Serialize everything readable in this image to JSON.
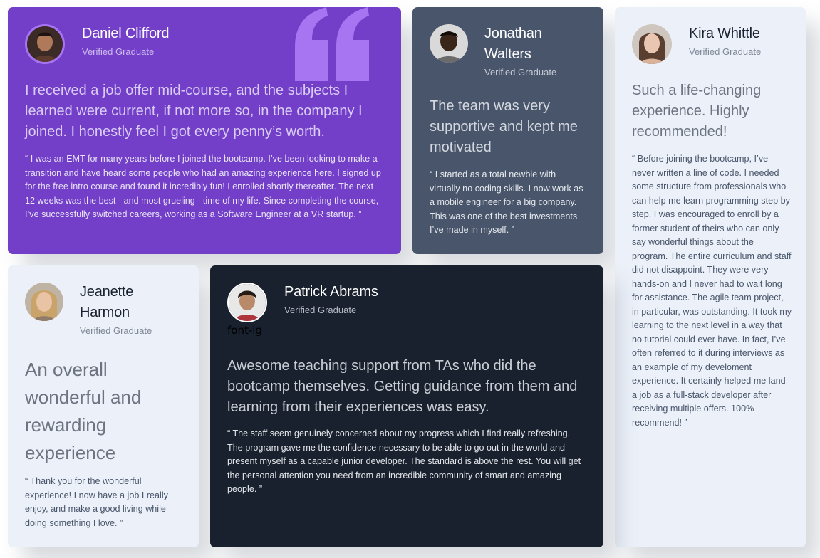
{
  "colors": {
    "purple": "#733fc8",
    "slate": "#48556a",
    "light": "#ecf1f9",
    "dark": "#19212e",
    "quote_mark": "#a775f1"
  },
  "testimonials": [
    {
      "name": "Daniel Clifford",
      "role": "Verified Graduate",
      "headline": "I received a job offer mid-course, and the subjects I learned were current, if not more so, in the company I joined. I honestly feel I got every penny’s worth.",
      "quote": "“ I was an EMT for many years before I joined the bootcamp. I’ve been looking to make a transition and have heard some people who had an amazing experience here. I signed up for the free intro course and found it incredibly fun! I enrolled shortly thereafter. The next 12 weeks was the best - and most grueling - time of my life. Since completing the course, I’ve successfully switched careers, working as a Software Engineer at a VR startup. ”"
    },
    {
      "name": "Jonathan Walters",
      "role": "Verified Graduate",
      "headline": "The team was very supportive and kept me motivated",
      "quote": "“ I started as a total newbie with virtually no coding skills. I now work as a mobile engineer for a big company. This was one of the best investments I’ve made in myself. ”"
    },
    {
      "name": "Kira Whittle",
      "role": "Verified Graduate",
      "headline": "Such a life-changing experience. Highly recommended!",
      "quote": "“ Before joining the bootcamp, I’ve never written a line of code. I needed some structure from professionals who can help me learn programming step by step. I was encouraged to enroll by a former student of theirs who can only say wonderful things about the program. The entire curriculum and staff did not disappoint. They were very hands-on and I never had to wait long for assistance. The agile team project, in particular, was outstanding. It took my learning to the next level in a way that no tutorial could ever have. In fact, I’ve often referred to it during interviews as an example of my develoment experience. It certainly helped me land a job as a full-stack developer after receiving multiple offers. 100% recommend! ”"
    },
    {
      "name": "Jeanette Harmon",
      "role": "Verified Graduate",
      "headline": "An overall wonderful and rewarding experience",
      "quote": "“ Thank you for the wonderful experience! I now have a job I really enjoy, and make a good living while doing something I love. ”"
    },
    {
      "name": "Patrick Abrams",
      "role": "Verified Graduate",
      "stray_label": "font-lg",
      "headline": "Awesome teaching support from TAs who did the bootcamp themselves. Getting guidance from them and learning from their experiences was easy.",
      "quote": "“ The staff seem genuinely concerned about my progress which I find really refreshing. The program gave me the confidence necessary to be able to go out in the world and present myself as a capable junior developer. The standard is above the rest. You will get the personal attention you need from an incredible community of smart and amazing people. ”"
    }
  ]
}
